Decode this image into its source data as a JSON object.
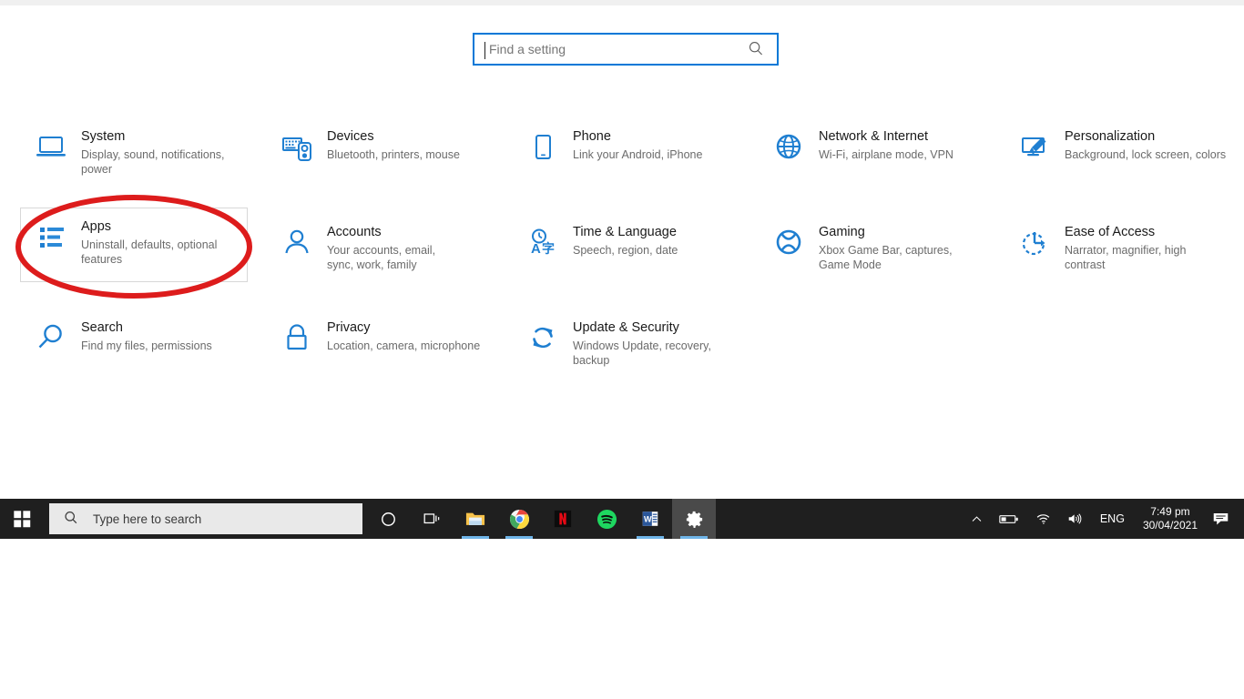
{
  "window": {
    "app_title": "Settings"
  },
  "search": {
    "placeholder": "Find a setting",
    "value": "",
    "icon": "search-icon"
  },
  "colors": {
    "accent_blue": "#0078d7",
    "icon_blue": "#1f7fd1",
    "annotation_red": "#dd1c1c",
    "taskbar": "#1f1f1f",
    "title_text": "#1a1a1a",
    "sub_text": "#6b6b6b"
  },
  "categories": [
    {
      "title": "System",
      "subtitle": "Display, sound, notifications, power",
      "icon": "monitor-icon",
      "highlighted": false
    },
    {
      "title": "Devices",
      "subtitle": "Bluetooth, printers, mouse",
      "icon": "keyboard-device-icon",
      "highlighted": false
    },
    {
      "title": "Phone",
      "subtitle": "Link your Android, iPhone",
      "icon": "phone-icon",
      "highlighted": false
    },
    {
      "title": "Network & Internet",
      "subtitle": "Wi-Fi, airplane mode, VPN",
      "icon": "globe-icon",
      "highlighted": false
    },
    {
      "title": "Personalization",
      "subtitle": "Background, lock screen, colors",
      "icon": "paintbrush-monitor-icon",
      "highlighted": false
    },
    {
      "title": "Apps",
      "subtitle": "Uninstall, defaults, optional features",
      "icon": "app-list-icon",
      "highlighted": true
    },
    {
      "title": "Accounts",
      "subtitle": "Your accounts, email, sync, work, family",
      "icon": "person-icon",
      "highlighted": false
    },
    {
      "title": "Time & Language",
      "subtitle": "Speech, region, date",
      "icon": "clock-language-icon",
      "highlighted": false
    },
    {
      "title": "Gaming",
      "subtitle": "Xbox Game Bar, captures, Game Mode",
      "icon": "xbox-icon",
      "highlighted": false
    },
    {
      "title": "Ease of Access",
      "subtitle": "Narrator, magnifier, high contrast",
      "icon": "ease-of-access-icon",
      "highlighted": false
    },
    {
      "title": "Search",
      "subtitle": "Find my files, permissions",
      "icon": "magnifier-icon",
      "highlighted": false
    },
    {
      "title": "Privacy",
      "subtitle": "Location, camera, microphone",
      "icon": "lock-icon",
      "highlighted": false
    },
    {
      "title": "Update & Security",
      "subtitle": "Windows Update, recovery, backup",
      "icon": "refresh-icon",
      "highlighted": false
    }
  ],
  "annotation": {
    "shape": "ellipse",
    "target": "Apps",
    "color": "#dd1c1c"
  },
  "taskbar": {
    "start_icon": "windows-start-icon",
    "search": {
      "placeholder": "Type here to search",
      "icon": "search-icon"
    },
    "items": [
      {
        "name": "cortana-icon",
        "label": "Cortana",
        "active": false,
        "running": false
      },
      {
        "name": "task-view-icon",
        "label": "Task View",
        "active": false,
        "running": false
      },
      {
        "name": "file-explorer-icon",
        "label": "File Explorer",
        "active": false,
        "running": true
      },
      {
        "name": "chrome-icon",
        "label": "Google Chrome",
        "active": false,
        "running": true
      },
      {
        "name": "netflix-icon",
        "label": "Netflix",
        "active": false,
        "running": false
      },
      {
        "name": "spotify-icon",
        "label": "Spotify",
        "active": false,
        "running": false
      },
      {
        "name": "word-icon",
        "label": "Microsoft Word",
        "active": false,
        "running": true
      },
      {
        "name": "settings-gear-icon",
        "label": "Settings",
        "active": true,
        "running": true
      }
    ],
    "tray": {
      "show_hidden_icon": "chevron-up-icon",
      "battery_icon": "battery-icon",
      "network_icon": "wifi-icon",
      "volume_icon": "volume-icon",
      "language": "ENG",
      "time": "7:49 pm",
      "date": "30/04/2021",
      "notifications_icon": "notification-icon"
    }
  }
}
